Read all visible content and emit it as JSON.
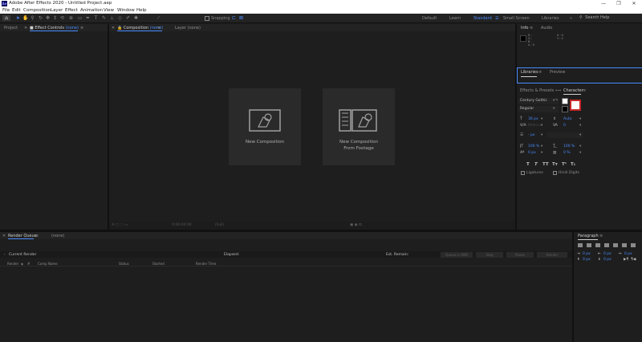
{
  "window": {
    "title": "Adobe After Effects 2020 - Untitled Project.aep",
    "logo": "Ae",
    "controls": [
      "—",
      "❐",
      "✕"
    ]
  },
  "menu": [
    "File",
    "Edit",
    "Composition",
    "Layer",
    "Effect",
    "Animation",
    "View",
    "Window",
    "Help"
  ],
  "toolbar": {
    "snapping_label": "Snapping",
    "workspaces": [
      "Default",
      "Learn",
      "Standard",
      "Small Screen",
      "Libraries"
    ],
    "active_workspace": "Standard",
    "search_placeholder": "Search Help"
  },
  "panels": {
    "project_tab": "Project",
    "effect_controls_tab": "Effect Controls",
    "effect_controls_none": "(none)",
    "composition_tab": "Composition",
    "composition_none": "(none)",
    "layer_tab": "Layer",
    "layer_none": "(none)",
    "info_tab": "Info",
    "audio_tab": "Audio",
    "info_values": {
      "r": "R :",
      "g": "G :",
      "b": "B :",
      "a": "A : 0",
      "x": "X : 0",
      "y": "Y : 0"
    },
    "libraries_tab": "Libraries",
    "preview_tab": "Preview",
    "effects_presets_tab": "Effects & Presets",
    "character_tab": "Character",
    "paragraph_tab": "Paragraph",
    "render_queue_tab": "Render Queue",
    "render_queue_none": "(none)"
  },
  "composition": {
    "new_comp_label": "New Composition",
    "new_comp_footage_label_line1": "New Composition",
    "new_comp_footage_label_line2": "From Footage",
    "zoom": "(Full)",
    "footer_time": "0:00:00:00"
  },
  "character": {
    "font": "Century Gothic",
    "style": "Regular",
    "size": "36 px",
    "leading": "Auto",
    "kerning": "Metrics",
    "tracking": "0",
    "stroke_width": "- px",
    "vertical_scale": "100 %",
    "horizontal_scale": "100 %",
    "baseline_shift": "0 px",
    "tsume": "0 %",
    "type_styles": [
      "T",
      "T",
      "TT",
      "Tт",
      "T¹",
      "T₁"
    ],
    "ligatures_label": "Ligatures",
    "hindi_digits_label": "Hindi Digits"
  },
  "paragraph": {
    "indent_left": "0 px",
    "indent_right": "0 px",
    "indent_first": "0 px",
    "space_before": "0 px",
    "space_after": "0 px"
  },
  "render_queue": {
    "current_render_label": "Current Render",
    "elapsed_label": "Elapsed:",
    "est_remain_label": "Est. Remain:",
    "buttons": [
      "Queue in AME",
      "Stop",
      "Pause",
      "Render"
    ],
    "columns": [
      "Render",
      "#",
      "Comp Name",
      "Status",
      "Started",
      "Render Time"
    ]
  },
  "colors": {
    "accent": "#4a8cff",
    "panel_bg": "#1e1e1e",
    "card_bg": "#2a2a2a"
  }
}
